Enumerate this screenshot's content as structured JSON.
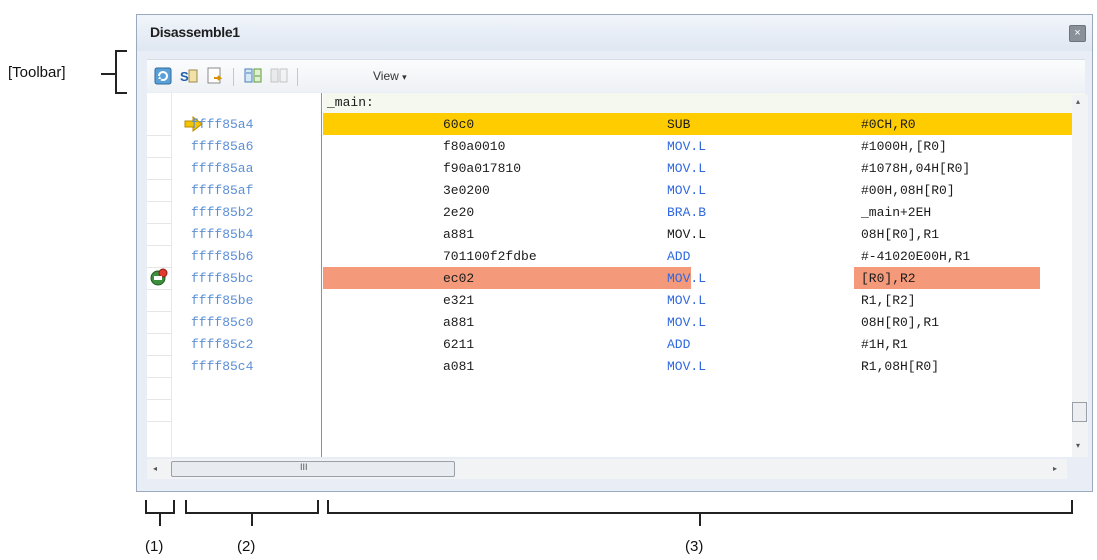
{
  "window": {
    "title": "Disassemble1",
    "close_glyph": "×"
  },
  "toolbar": {
    "annotation": "[Toolbar]",
    "view_label": "View",
    "view_arrow": "▾",
    "buttons": [
      "refresh-icon",
      "symbol-icon",
      "go-to-icon",
      "source-mix-icon",
      "step-icon"
    ]
  },
  "disasm": {
    "label_line": "_main:",
    "rows": [
      {
        "address": "ffff85a4",
        "code": "60c0",
        "mnemonic": "SUB",
        "operand": "#0CH,R0"
      },
      {
        "address": "ffff85a6",
        "code": "f80a0010",
        "mnemonic": "MOV.L",
        "operand": "#1000H,[R0]"
      },
      {
        "address": "ffff85aa",
        "code": "f90a017810",
        "mnemonic": "MOV.L",
        "operand": "#1078H,04H[R0]"
      },
      {
        "address": "ffff85af",
        "code": "3e0200",
        "mnemonic": "MOV.L",
        "operand": "#00H,08H[R0]"
      },
      {
        "address": "ffff85b2",
        "code": "2e20",
        "mnemonic": "BRA.B",
        "operand": "_main+2EH"
      },
      {
        "address": "ffff85b4",
        "code": "a881",
        "mnemonic": "MOV.L",
        "operand": "08H[R0],R1"
      },
      {
        "address": "ffff85b6",
        "code": "701100f2fdbe",
        "mnemonic": "ADD",
        "operand": "#-41020E00H,R1"
      },
      {
        "address": "ffff85bc",
        "code": "ec02",
        "mnemonic": "MOV.L",
        "operand": "[R0],R2"
      },
      {
        "address": "ffff85be",
        "code": "e321",
        "mnemonic": "MOV.L",
        "operand": "R1,[R2]"
      },
      {
        "address": "ffff85c0",
        "code": "a881",
        "mnemonic": "MOV.L",
        "operand": "08H[R0],R1"
      },
      {
        "address": "ffff85c2",
        "code": "6211",
        "mnemonic": "ADD",
        "operand": "#1H,R1"
      },
      {
        "address": "ffff85c4",
        "code": "a081",
        "mnemonic": "MOV.L",
        "operand": "R1,08H[R0]"
      }
    ]
  },
  "scroll": {
    "hthumb_glyph": "III",
    "left": "◂",
    "right": "▸",
    "up": "▴",
    "down": "▾"
  },
  "annotations": {
    "a1": "(1)",
    "a2": "(2)",
    "a3": "(3)"
  },
  "colors": {
    "pc_highlight": "#ffcc00",
    "breakpoint_highlight": "#f49a7b",
    "address": "#5b8fd6",
    "mnemonic_blue": "#2f68e0"
  }
}
